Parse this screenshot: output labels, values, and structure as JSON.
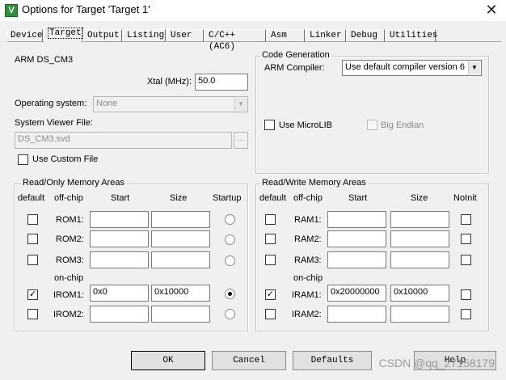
{
  "window": {
    "title": "Options for Target 'Target 1'",
    "icon_letter": "V"
  },
  "tabs": [
    {
      "label": "Device"
    },
    {
      "label": "Target"
    },
    {
      "label": "Output"
    },
    {
      "label": "Listing"
    },
    {
      "label": "User"
    },
    {
      "label": "C/C++ (AC6)"
    },
    {
      "label": "Asm"
    },
    {
      "label": "Linker"
    },
    {
      "label": "Debug"
    },
    {
      "label": "Utilities"
    }
  ],
  "target": {
    "device_name": "ARM DS_CM3",
    "xtal_label": "Xtal (MHz):",
    "xtal_value": "50.0",
    "os_label": "Operating system:",
    "os_value": "None",
    "svd_label": "System Viewer File:",
    "svd_value": "DS_CM3.svd",
    "browse_label": "...",
    "custom_file_label": "Use Custom File"
  },
  "codegen": {
    "title": "Code Generation",
    "compiler_label": "ARM Compiler:",
    "compiler_value": "Use default compiler version 6",
    "microlib_label": "Use MicroLIB",
    "bigendian_label": "Big Endian"
  },
  "rom": {
    "title": "Read/Only Memory Areas",
    "headers": {
      "default": "default",
      "offchip": "off-chip",
      "start": "Start",
      "size": "Size",
      "last": "Startup"
    },
    "onchip_label": "on-chip",
    "rows": [
      {
        "name": "ROM1:",
        "start": "",
        "size": "",
        "default": false,
        "selected": false
      },
      {
        "name": "ROM2:",
        "start": "",
        "size": "",
        "default": false,
        "selected": false
      },
      {
        "name": "ROM3:",
        "start": "",
        "size": "",
        "default": false,
        "selected": false
      },
      {
        "name": "IROM1:",
        "start": "0x0",
        "size": "0x10000",
        "default": true,
        "selected": true
      },
      {
        "name": "IROM2:",
        "start": "",
        "size": "",
        "default": false,
        "selected": false
      }
    ]
  },
  "ram": {
    "title": "Read/Write Memory Areas",
    "headers": {
      "default": "default",
      "offchip": "off-chip",
      "start": "Start",
      "size": "Size",
      "last": "NoInit"
    },
    "onchip_label": "on-chip",
    "rows": [
      {
        "name": "RAM1:",
        "start": "",
        "size": "",
        "default": false,
        "noinit": false
      },
      {
        "name": "RAM2:",
        "start": "",
        "size": "",
        "default": false,
        "noinit": false
      },
      {
        "name": "RAM3:",
        "start": "",
        "size": "",
        "default": false,
        "noinit": false
      },
      {
        "name": "IRAM1:",
        "start": "0x20000000",
        "size": "0x10000",
        "default": true,
        "noinit": false
      },
      {
        "name": "IRAM2:",
        "start": "",
        "size": "",
        "default": false,
        "noinit": false
      }
    ]
  },
  "buttons": {
    "ok": "OK",
    "cancel": "Cancel",
    "defaults": "Defaults",
    "help": "Help"
  },
  "watermark": "CSDN @qq_27158179"
}
